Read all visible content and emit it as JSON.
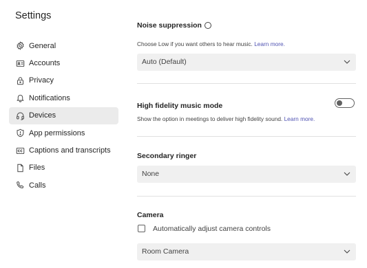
{
  "sidebar": {
    "title": "Settings",
    "items": [
      {
        "label": "General",
        "icon": "gear-icon"
      },
      {
        "label": "Accounts",
        "icon": "id-card-icon"
      },
      {
        "label": "Privacy",
        "icon": "lock-icon"
      },
      {
        "label": "Notifications",
        "icon": "bell-icon"
      },
      {
        "label": "Devices",
        "icon": "headset-icon",
        "active": true
      },
      {
        "label": "App permissions",
        "icon": "shield-icon"
      },
      {
        "label": "Captions and transcripts",
        "icon": "closed-captions-icon"
      },
      {
        "label": "Files",
        "icon": "file-icon"
      },
      {
        "label": "Calls",
        "icon": "phone-icon"
      }
    ]
  },
  "main": {
    "noise": {
      "title": "Noise suppression",
      "desc": "Choose Low if you want others to hear music.",
      "link": "Learn more.",
      "value": "Auto (Default)"
    },
    "hifi": {
      "title": "High fidelity music mode",
      "desc": "Show the option in meetings to deliver high fidelity sound.",
      "link": "Learn more.",
      "toggle_on": false
    },
    "ringer": {
      "title": "Secondary ringer",
      "value": "None"
    },
    "camera": {
      "title": "Camera",
      "checkbox_label": "Automatically adjust camera controls",
      "checkbox_checked": false,
      "value": "Room Camera"
    }
  },
  "colors": {
    "active_nav_bg": "#ebebeb",
    "link": "#4f52b2",
    "select_bg": "#f0f0f0"
  }
}
